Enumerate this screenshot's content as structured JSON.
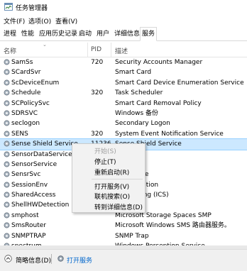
{
  "window": {
    "title": "任务管理器"
  },
  "menu": [
    "文件(F)",
    "选项(O)",
    "查看(V)"
  ],
  "tabs": [
    "进程",
    "性能",
    "应用历史记录",
    "启动",
    "用户",
    "详细信息",
    "服务"
  ],
  "active_tab": "服务",
  "columns": {
    "name": "名称",
    "pid": "PID",
    "desc": "描述"
  },
  "rows": [
    {
      "name": "SamSs",
      "pid": "720",
      "desc": "Security Accounts Manager"
    },
    {
      "name": "SCardSvr",
      "pid": "",
      "desc": "Smart Card"
    },
    {
      "name": "ScDeviceEnum",
      "pid": "",
      "desc": "Smart Card Device Enumeration Service"
    },
    {
      "name": "Schedule",
      "pid": "320",
      "desc": "Task Scheduler"
    },
    {
      "name": "SCPolicySvc",
      "pid": "",
      "desc": "Smart Card Removal Policy"
    },
    {
      "name": "SDRSVC",
      "pid": "",
      "desc": "Windows 备份"
    },
    {
      "name": "seclogon",
      "pid": "",
      "desc": "Secondary Logon"
    },
    {
      "name": "SENS",
      "pid": "320",
      "desc": "System Event Notification Service"
    },
    {
      "name": "Sense Shield Service",
      "pid": "11236",
      "desc": "Sense Shield Service",
      "selected": true
    },
    {
      "name": "SensorDataService",
      "pid": "",
      "desc": "ervice"
    },
    {
      "name": "SensorService",
      "pid": "",
      "desc": ""
    },
    {
      "name": "SensrSvc",
      "pid": "",
      "desc": "ng Service"
    },
    {
      "name": "SessionEnv",
      "pid": "",
      "desc": "Configuration"
    },
    {
      "name": "SharedAccess",
      "pid": "",
      "desc": "ion Sharing (ICS)"
    },
    {
      "name": "ShellHWDetection",
      "pid": "",
      "desc": "etection"
    },
    {
      "name": "smphost",
      "pid": "",
      "desc": "Microsoft Storage Spaces SMP"
    },
    {
      "name": "SmsRouter",
      "pid": "",
      "desc": "Microsoft Windows SMS 路由器服务。"
    },
    {
      "name": "SNMPTRAP",
      "pid": "",
      "desc": "SNMP Trap"
    },
    {
      "name": "spectrum",
      "pid": "",
      "desc": "Windows Perception Service"
    }
  ],
  "context_menu": {
    "start": "开始(S)",
    "stop": "停止(T)",
    "restart": "重新启动(R)",
    "open_services": "打开服务(V)",
    "search_online": "联机搜索(O)",
    "go_to_details": "转到详细信息(D)"
  },
  "footer": {
    "fewer_details": "简略信息(D)",
    "open_services": "打开服务"
  },
  "colors": {
    "selection": "#cce8ff",
    "link": "#0066cc"
  }
}
